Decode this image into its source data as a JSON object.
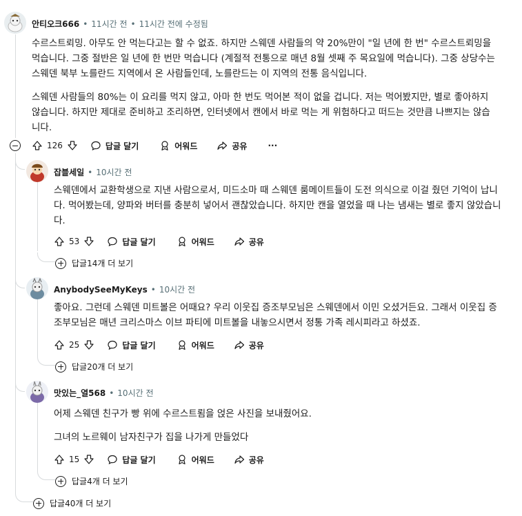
{
  "comments": [
    {
      "author": "안티오크666",
      "time": "11시간 전",
      "edited": "11시간 전에 수정됨",
      "paragraphs": [
        "수르스트뢰밍. 아무도 안 먹는다고는 할 수 없죠. 하지만 스웨덴 사람들의 약 20%만이 \"일 년에 한 번\" 수르스트뢰밍을 먹습니다. 그중 절반은 일 년에 한 번만 먹습니다 (계절적 전통으로 매년 8월 셋째 주 목요일에 먹습니다). 그중 상당수는 스웨덴 북부 노를란드 지역에서 온 사람들인데, 노를란드는 이 지역의 전통 음식입니다.",
        "스웨덴 사람들의 80%는 이 요리를 먹지 않고, 아마 한 번도 먹어본 적이 없을 겁니다. 저는 먹어봤지만, 별로 좋아하지 않습니다. 하지만 제대로 준비하고 조리하면, 인터넷에서 캔에서 바로 먹는 게 위험하다고 떠드는 것만큼 나쁘지는 않습니다."
      ],
      "votes": "126",
      "reply_label": "답글 달기",
      "award_label": "어워드",
      "share_label": "공유",
      "more_label": "···"
    },
    {
      "author": "잡블세일",
      "time": "10시간 전",
      "paragraphs": [
        "스웨덴에서 교환학생으로 지낸 사람으로서, 미드소마 때 스웨덴 룸메이트들이 도전 의식으로 이걸 줬던 기억이 납니다. 먹어봤는데, 양파와 버터를 충분히 넣어서 괜찮았습니다. 하지만 캔을 열었을 때 나는 냄새는 별로 좋지 않았습니다."
      ],
      "votes": "53",
      "reply_label": "답글 달기",
      "award_label": "어워드",
      "share_label": "공유",
      "more_replies": "답글14개 더 보기"
    },
    {
      "author": "AnybodySeeMyKeys",
      "time": "10시간 전",
      "paragraphs": [
        "좋아요. 그런데 스웨덴 미트볼은 어때요? 우리 이웃집 증조부모님은 스웨덴에서 이민 오셨거든요. 그래서 이웃집 증조부모님은 매년 크리스마스 이브 파티에 미트볼을 내놓으시면서 정통 가족 레시피라고 하셨죠."
      ],
      "votes": "25",
      "reply_label": "답글 달기",
      "award_label": "어워드",
      "share_label": "공유",
      "more_replies": "답글20개 더 보기"
    },
    {
      "author": "맛있는_열568",
      "time": "10시간 전",
      "paragraphs": [
        "어제 스웨덴 친구가 빵 위에 수르스트룀을 얹은 사진을 보내줬어요.",
        "그녀의 노르웨이 남자친구가 집을 나가게 만들었다"
      ],
      "votes": "15",
      "reply_label": "답글 달기",
      "award_label": "어워드",
      "share_label": "공유",
      "more_replies": "답글4개 더 보기"
    }
  ],
  "thread_more_replies": "답글40개 더 보기",
  "colors": {
    "meta": "#576f76",
    "thread_line": "#d7dadc",
    "text": "#1c1c1c"
  }
}
